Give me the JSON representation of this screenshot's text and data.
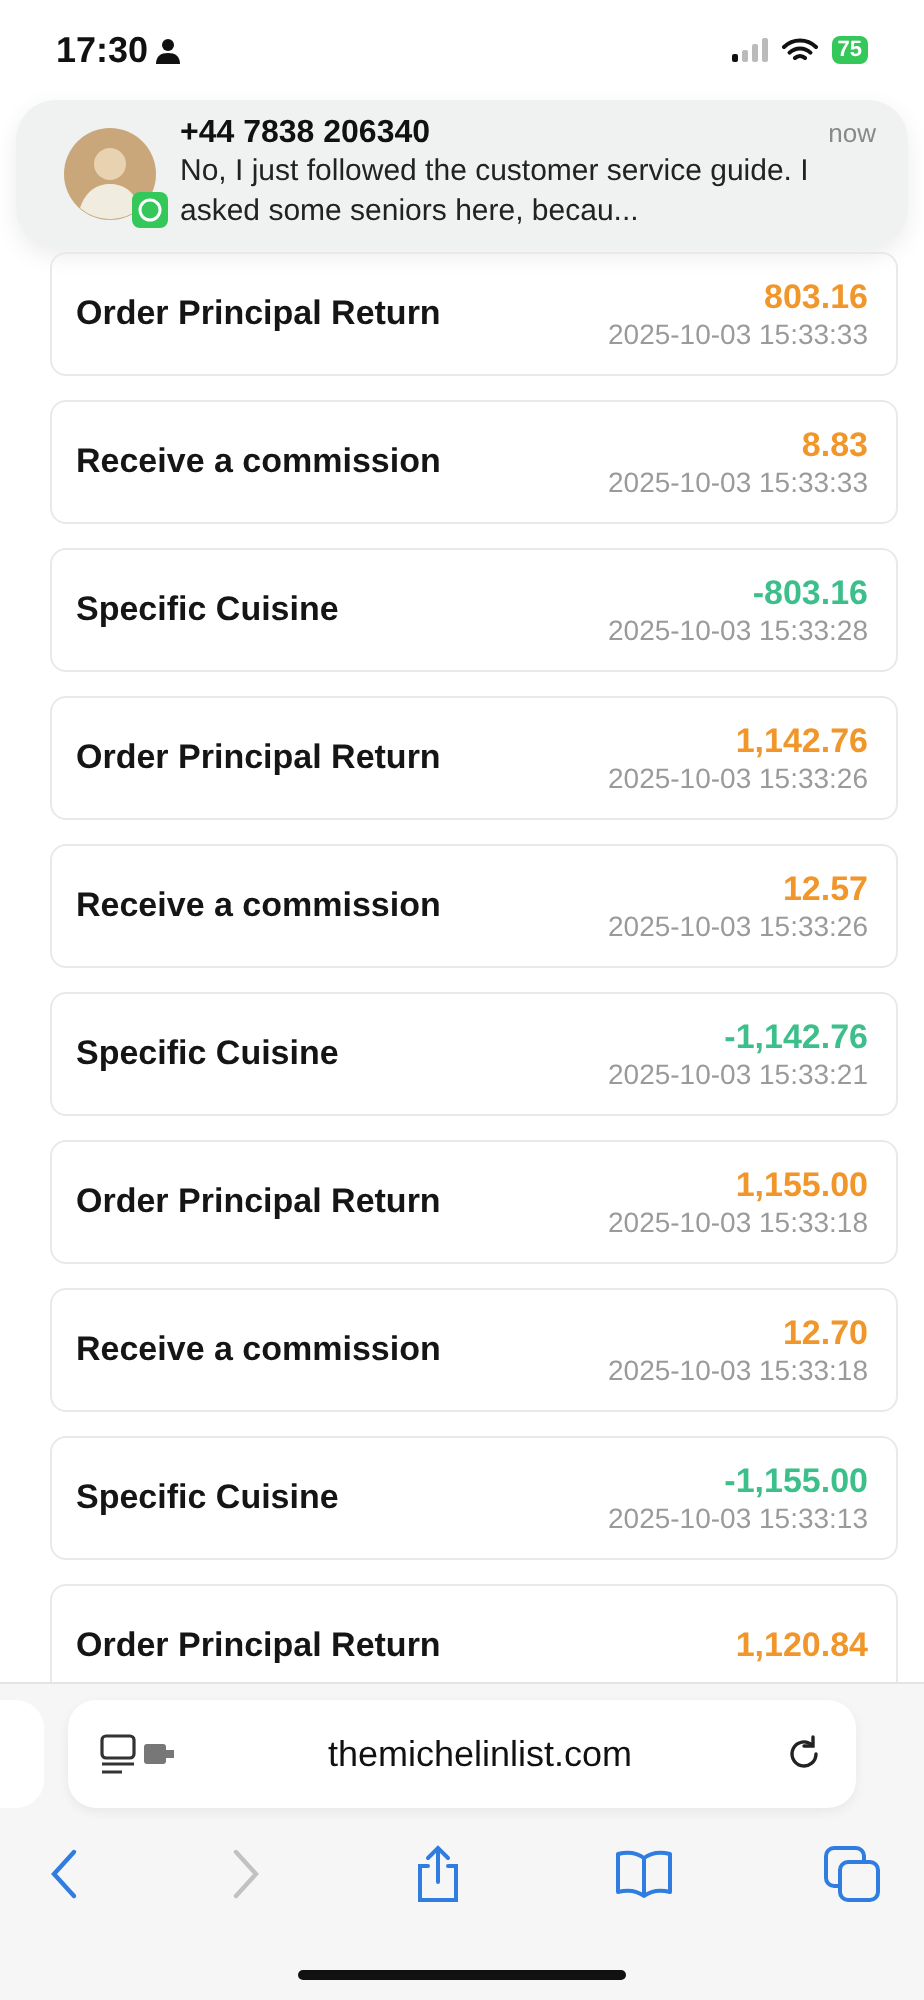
{
  "status_bar": {
    "time": "17:30",
    "battery": "75"
  },
  "notification": {
    "sender": "+44 7838 206340",
    "time": "now",
    "message": "No, I just followed the customer service guide. I asked some seniors here, becau..."
  },
  "transactions": [
    {
      "title": "Order Principal Return",
      "amount": "803.16",
      "color": "#f0962a",
      "time": "2025-10-03 15:33:33"
    },
    {
      "title": "Receive a commission",
      "amount": "8.83",
      "color": "#f0962a",
      "time": "2025-10-03 15:33:33"
    },
    {
      "title": "Specific Cuisine",
      "amount": "-803.16",
      "color": "#3dbf8c",
      "time": "2025-10-03 15:33:28"
    },
    {
      "title": "Order Principal Return",
      "amount": "1,142.76",
      "color": "#f0962a",
      "time": "2025-10-03 15:33:26"
    },
    {
      "title": "Receive a commission",
      "amount": "12.57",
      "color": "#f0962a",
      "time": "2025-10-03 15:33:26"
    },
    {
      "title": "Specific Cuisine",
      "amount": "-1,142.76",
      "color": "#3dbf8c",
      "time": "2025-10-03 15:33:21"
    },
    {
      "title": "Order Principal Return",
      "amount": "1,155.00",
      "color": "#f0962a",
      "time": "2025-10-03 15:33:18"
    },
    {
      "title": "Receive a commission",
      "amount": "12.70",
      "color": "#f0962a",
      "time": "2025-10-03 15:33:18"
    },
    {
      "title": "Specific Cuisine",
      "amount": "-1,155.00",
      "color": "#3dbf8c",
      "time": "2025-10-03 15:33:13"
    },
    {
      "title": "Order Principal Return",
      "amount": "1,120.84",
      "color": "#f0962a"
    }
  ],
  "browser": {
    "url": "themichelinlist.com",
    "back": {
      "disabled": false
    },
    "forward": {
      "disabled": true
    }
  }
}
